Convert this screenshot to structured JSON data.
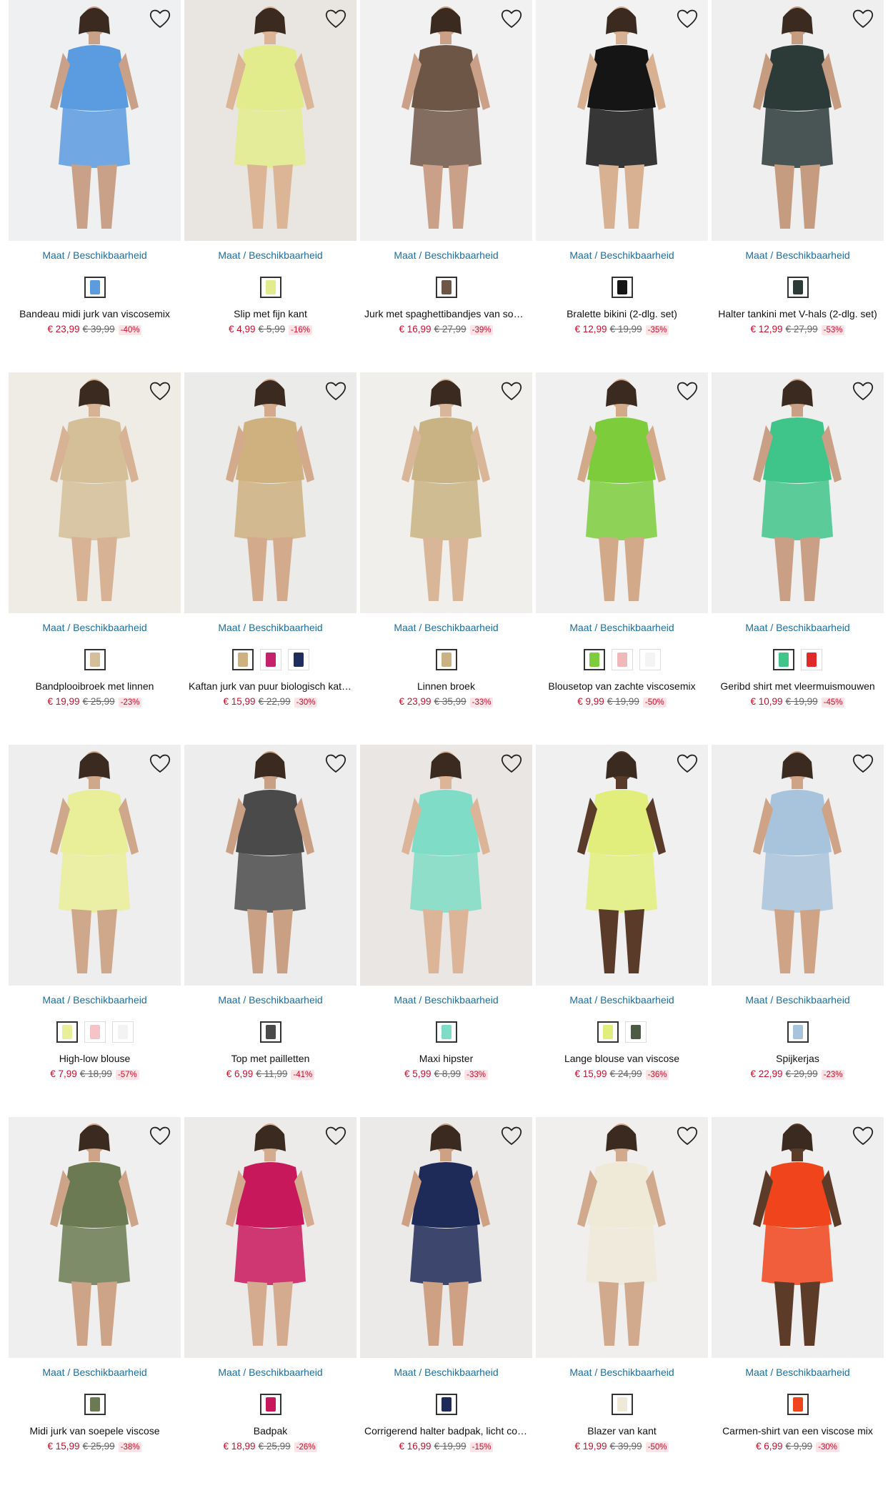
{
  "availability_label": "Maat / Beschikbaarheid",
  "products": [
    {
      "name": "Bandeau midi jurk van viscosemix",
      "price": "€ 23,99",
      "old_price": "€ 39,99",
      "discount": "-40%",
      "bg": "#eef0f2",
      "garment": "#5b9be0",
      "skin": "#c9a189",
      "swatches": [
        "#5b9be0"
      ]
    },
    {
      "name": "Slip met fijn kant",
      "price": "€ 4,99",
      "old_price": "€ 5,99",
      "discount": "-16%",
      "bg": "#e9e6e2",
      "garment": "#e3ec8c",
      "skin": "#dcb596",
      "swatches": [
        "#e3ec8c"
      ]
    },
    {
      "name": "Jurk met spaghettibandjes van soepele viscose",
      "price": "€ 16,99",
      "old_price": "€ 27,99",
      "discount": "-39%",
      "bg": "#f1f1f1",
      "garment": "#6e5646",
      "skin": "#caa088",
      "swatches": [
        "#6e5646"
      ]
    },
    {
      "name": "Bralette bikini (2-dlg. set)",
      "price": "€ 12,99",
      "old_price": "€ 19,99",
      "discount": "-35%",
      "bg": "#f2f2f2",
      "garment": "#151515",
      "skin": "#d8b092",
      "swatches": [
        "#151515"
      ]
    },
    {
      "name": "Halter tankini met V-hals (2-dlg. set)",
      "price": "€ 12,99",
      "old_price": "€ 27,99",
      "discount": "-53%",
      "bg": "#efefef",
      "garment": "#2c3a38",
      "skin": "#c69c80",
      "swatches": [
        "#2c3a38"
      ]
    },
    {
      "name": "Bandplooibroek met linnen",
      "price": "€ 19,99",
      "old_price": "€ 25,99",
      "discount": "-23%",
      "bg": "#efece6",
      "garment": "#d4bf98",
      "skin": "#d7b294",
      "swatches": [
        "#d4bf98"
      ]
    },
    {
      "name": "Kaftan jurk van puur biologisch katoen",
      "price": "€ 15,99",
      "old_price": "€ 22,99",
      "discount": "-30%",
      "bg": "#ebebea",
      "garment": "#cfb07f",
      "skin": "#d4aa8c",
      "swatches": [
        "#cfb07f",
        "#c5206a",
        "#1f2d5c"
      ]
    },
    {
      "name": "Linnen broek",
      "price": "€ 23,99",
      "old_price": "€ 35,99",
      "discount": "-33%",
      "bg": "#f0efec",
      "garment": "#c9b384",
      "skin": "#d9b698",
      "swatches": [
        "#c9b384"
      ]
    },
    {
      "name": "Blousetop van zachte viscosemix",
      "price": "€ 9,99",
      "old_price": "€ 19,99",
      "discount": "-50%",
      "bg": "#f0f0f0",
      "garment": "#7ccc3c",
      "skin": "#d2aa8a",
      "swatches": [
        "#7ccc3c",
        "#f0b8b8",
        "#f4f4f4"
      ]
    },
    {
      "name": "Geribd shirt met vleermuismouwen",
      "price": "€ 10,99",
      "old_price": "€ 19,99",
      "discount": "-45%",
      "bg": "#efefef",
      "garment": "#3fc48a",
      "skin": "#c9a085",
      "swatches": [
        "#3fc48a",
        "#e02a2a"
      ]
    },
    {
      "name": "High-low blouse",
      "price": "€ 7,99",
      "old_price": "€ 18,99",
      "discount": "-57%",
      "bg": "#eeeeee",
      "garment": "#e9ef98",
      "skin": "#cfa78a",
      "swatches": [
        "#e9ef98",
        "#f6c3c7",
        "#f3f3f3"
      ]
    },
    {
      "name": "Top met pailletten",
      "price": "€ 6,99",
      "old_price": "€ 11,99",
      "discount": "-41%",
      "bg": "#ededed",
      "garment": "#4a4a4a",
      "skin": "#caa085",
      "swatches": [
        "#4a4a4a"
      ]
    },
    {
      "name": "Maxi hipster",
      "price": "€ 5,99",
      "old_price": "€ 8,99",
      "discount": "-33%",
      "bg": "#e9e6e3",
      "garment": "#7fdcc6",
      "skin": "#dcb598",
      "swatches": [
        "#7fdcc6"
      ]
    },
    {
      "name": "Lange blouse van viscose",
      "price": "€ 15,99",
      "old_price": "€ 24,99",
      "discount": "-36%",
      "bg": "#f0f0f0",
      "garment": "#e2ee7c",
      "skin": "#5a3a28",
      "swatches": [
        "#e2ee7c",
        "#4d5a44"
      ]
    },
    {
      "name": "Spijkerjas",
      "price": "€ 22,99",
      "old_price": "€ 29,99",
      "discount": "-23%",
      "bg": "#efefef",
      "garment": "#a8c3dc",
      "skin": "#cfa385",
      "swatches": [
        "#a8c3dc"
      ]
    },
    {
      "name": "Midi jurk van soepele viscose",
      "price": "€ 15,99",
      "old_price": "€ 25,99",
      "discount": "-38%",
      "bg": "#efefef",
      "garment": "#6b7a52",
      "skin": "#cda487",
      "swatches": [
        "#6b7a52"
      ]
    },
    {
      "name": "Badpak",
      "price": "€ 18,99",
      "old_price": "€ 25,99",
      "discount": "-26%",
      "bg": "#edebea",
      "garment": "#c8185c",
      "skin": "#d4ab8e",
      "swatches": [
        "#c8185c"
      ]
    },
    {
      "name": "Corrigerend halter badpak, licht corrigerend",
      "price": "€ 16,99",
      "old_price": "€ 19,99",
      "discount": "-15%",
      "bg": "#eceae8",
      "garment": "#1e2a58",
      "skin": "#cfa184",
      "swatches": [
        "#1e2a58"
      ]
    },
    {
      "name": "Blazer van kant",
      "price": "€ 19,99",
      "old_price": "€ 39,99",
      "discount": "-50%",
      "bg": "#f0efed",
      "garment": "#efe9d8",
      "skin": "#d1a98c",
      "swatches": [
        "#efe9d8"
      ]
    },
    {
      "name": "Carmen-shirt van een viscose mix",
      "price": "€ 6,99",
      "old_price": "€ 9,99",
      "discount": "-30%",
      "bg": "#efefef",
      "garment": "#f0441c",
      "skin": "#5c3b29",
      "swatches": [
        "#f0441c"
      ]
    }
  ]
}
